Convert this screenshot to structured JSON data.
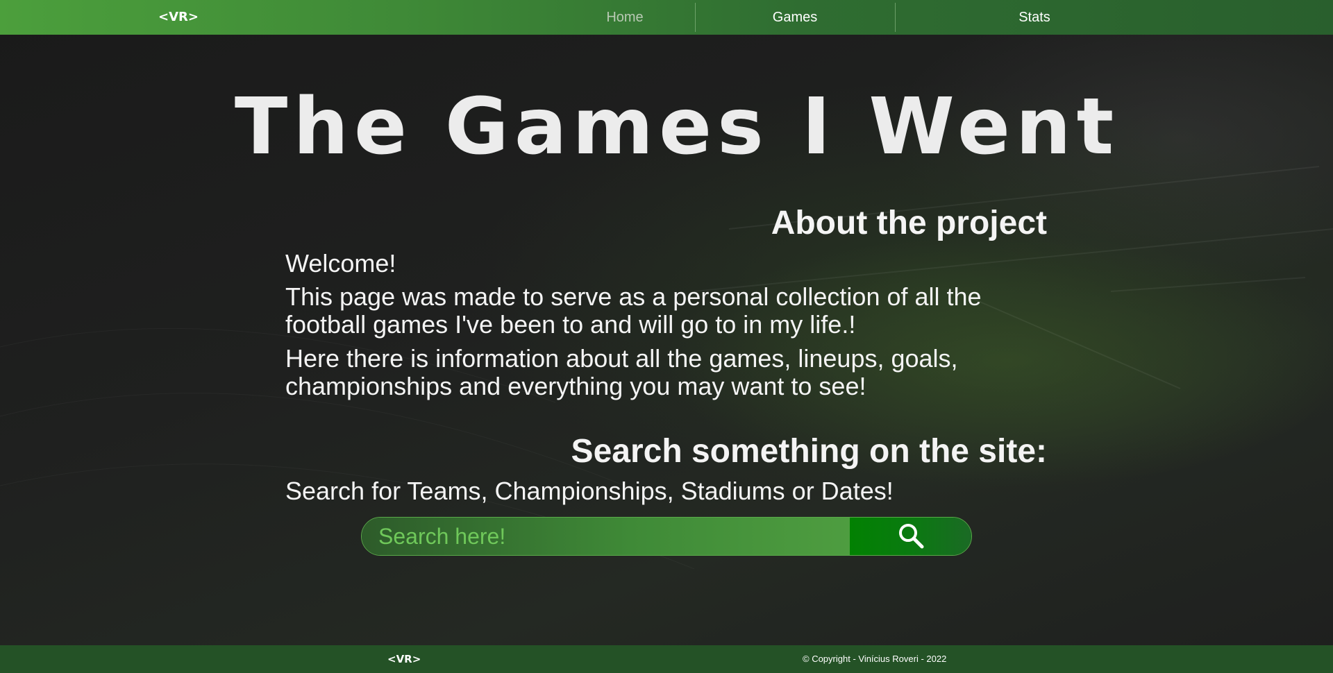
{
  "nav": {
    "logo": "<VR>",
    "items": [
      {
        "label": "Home",
        "active": true
      },
      {
        "label": "Games",
        "active": false
      },
      {
        "label": "Stats",
        "active": false
      }
    ]
  },
  "hero": {
    "title": "The Games I Went"
  },
  "about": {
    "heading": "About the project",
    "welcome": "Welcome!",
    "paragraph1": "This page was made to serve as a personal collection of all the football games I've been to and will go to in my life.!",
    "paragraph2": "Here there is information about all the games, lineups, goals, championships and everything you may want to see!"
  },
  "search": {
    "heading": "Search something on the site:",
    "subtitle": "Search for Teams, Championships, Stadiums or Dates!",
    "placeholder": "Search here!",
    "button_icon": "search-icon"
  },
  "footer": {
    "logo": "<VR>",
    "copyright": "© Copyright - Vinícius Roveri - 2022"
  },
  "colors": {
    "nav_green": "#3f8a37",
    "footer_green": "#245226",
    "search_button": "#028102",
    "background": "#1c1d1c"
  }
}
